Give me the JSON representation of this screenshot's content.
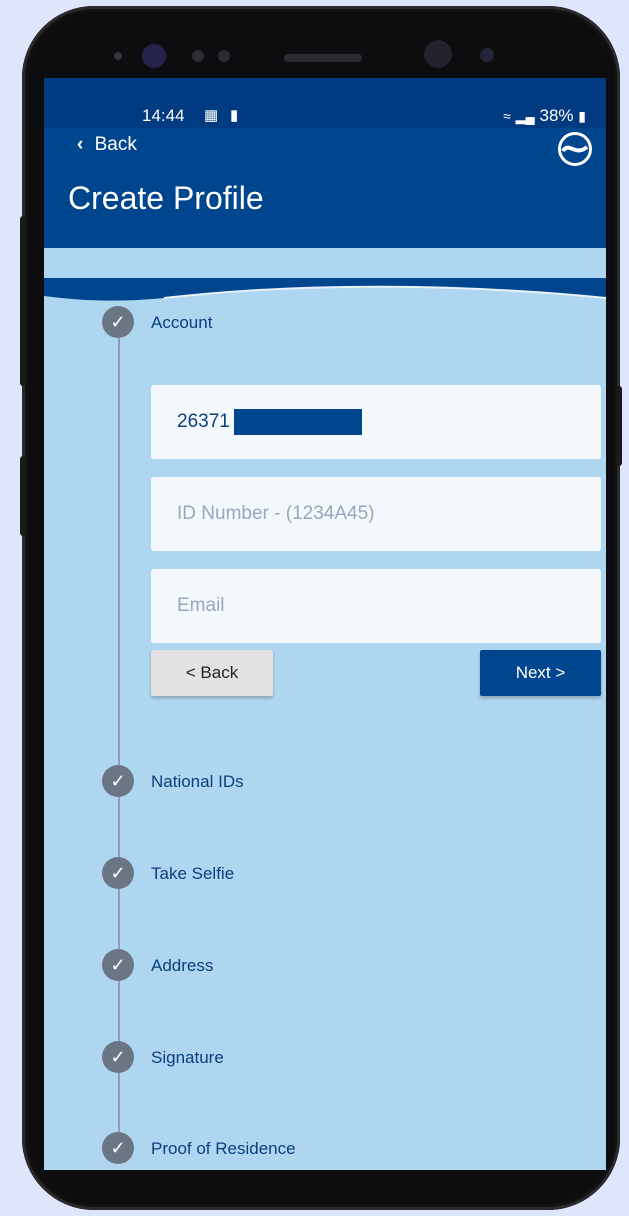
{
  "status_bar": {
    "time": "14:44",
    "battery": "38%"
  },
  "header": {
    "back_label": "Back",
    "title": "Create Profile"
  },
  "steps": [
    {
      "label": "Account"
    },
    {
      "label": "National IDs"
    },
    {
      "label": "Take Selfie"
    },
    {
      "label": "Address"
    },
    {
      "label": "Signature"
    },
    {
      "label": "Proof of Residence"
    }
  ],
  "form": {
    "phone_value": "26371",
    "id_placeholder": "ID Number - (1234A45)",
    "email_placeholder": "Email",
    "back_button": "< Back",
    "next_button": "Next >"
  },
  "colors": {
    "header_blue": "#00468f",
    "screen_bg": "#aed6f0",
    "step_check": "#6b7685"
  }
}
